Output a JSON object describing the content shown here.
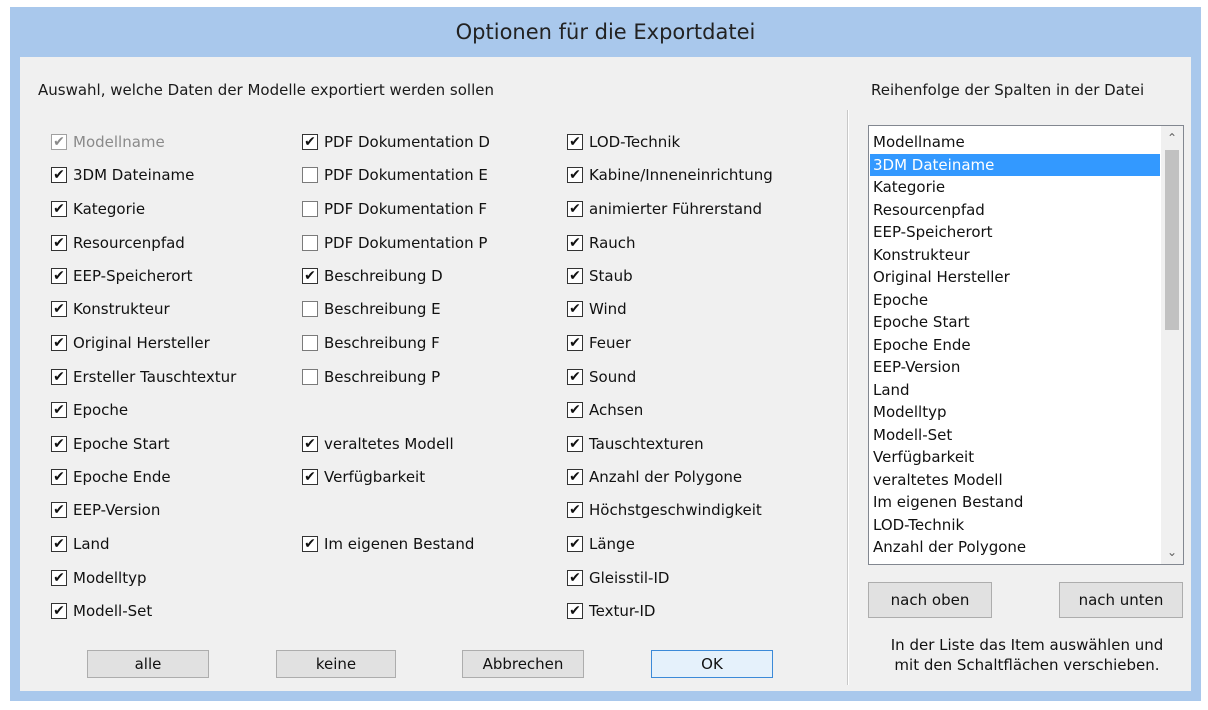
{
  "title": "Optionen für die Exportdatei",
  "left_heading": "Auswahl, welche Daten der Modelle exportiert werden sollen",
  "right_heading": "Reihenfolge der Spalten in der Datei",
  "col1": [
    {
      "label": "Modellname",
      "checked": true,
      "disabled": true
    },
    {
      "label": "3DM Dateiname",
      "checked": true
    },
    {
      "label": "Kategorie",
      "checked": true
    },
    {
      "label": "Resourcenpfad",
      "checked": true
    },
    {
      "label": "EEP-Speicherort",
      "checked": true
    },
    {
      "label": "Konstrukteur",
      "checked": true
    },
    {
      "label": "Original Hersteller",
      "checked": true
    },
    {
      "label": "Ersteller Tauschtextur",
      "checked": true
    },
    {
      "label": "Epoche",
      "checked": true
    },
    {
      "label": "Epoche Start",
      "checked": true
    },
    {
      "label": "Epoche Ende",
      "checked": true
    },
    {
      "label": "EEP-Version",
      "checked": true
    },
    {
      "label": "Land",
      "checked": true
    },
    {
      "label": "Modelltyp",
      "checked": true
    },
    {
      "label": "Modell-Set",
      "checked": true
    }
  ],
  "col2": [
    {
      "label": "PDF Dokumentation D",
      "checked": true
    },
    {
      "label": "PDF Dokumentation E",
      "checked": false
    },
    {
      "label": "PDF Dokumentation F",
      "checked": false
    },
    {
      "label": "PDF Dokumentation P",
      "checked": false
    },
    {
      "label": "Beschreibung D",
      "checked": true
    },
    {
      "label": "Beschreibung E",
      "checked": false
    },
    {
      "label": "Beschreibung F",
      "checked": false
    },
    {
      "label": "Beschreibung P",
      "checked": false
    },
    {
      "label": "veraltetes Modell",
      "checked": true
    },
    {
      "label": "Verfügbarkeit",
      "checked": true
    },
    {
      "label": "Im eigenen Bestand",
      "checked": true
    }
  ],
  "col3": [
    {
      "label": "LOD-Technik",
      "checked": true
    },
    {
      "label": "Kabine/Inneneinrichtung",
      "checked": true
    },
    {
      "label": "animierter Führerstand",
      "checked": true
    },
    {
      "label": "Rauch",
      "checked": true
    },
    {
      "label": "Staub",
      "checked": true
    },
    {
      "label": "Wind",
      "checked": true
    },
    {
      "label": "Feuer",
      "checked": true
    },
    {
      "label": "Sound",
      "checked": true
    },
    {
      "label": "Achsen",
      "checked": true
    },
    {
      "label": "Tauschtexturen",
      "checked": true
    },
    {
      "label": "Anzahl der Polygone",
      "checked": true
    },
    {
      "label": "Höchstgeschwindigkeit",
      "checked": true
    },
    {
      "label": "Länge",
      "checked": true
    },
    {
      "label": "Gleisstil-ID",
      "checked": true
    },
    {
      "label": "Textur-ID",
      "checked": true
    }
  ],
  "column_order": [
    "Modellname",
    "3DM Dateiname",
    "Kategorie",
    "Resourcenpfad",
    "EEP-Speicherort",
    "Konstrukteur",
    "Original Hersteller",
    "Epoche",
    "Epoche Start",
    "Epoche Ende",
    "EEP-Version",
    "Land",
    "Modelltyp",
    "Modell-Set",
    "Verfügbarkeit",
    "veraltetes Modell",
    "Im eigenen Bestand",
    "LOD-Technik",
    "Anzahl der Polygone"
  ],
  "selected_item": "3DM Dateiname",
  "buttons": {
    "all": "alle",
    "none": "keine",
    "cancel": "Abbrechen",
    "ok": "OK",
    "up": "nach oben",
    "down": "nach unten"
  },
  "hint_line1": "In der Liste das Item auswählen und",
  "hint_line2": "mit den Schaltflächen verschieben.",
  "icons": {
    "check": "check-icon",
    "scroll_up": "chevron-up-icon",
    "scroll_down": "chevron-down-icon"
  }
}
